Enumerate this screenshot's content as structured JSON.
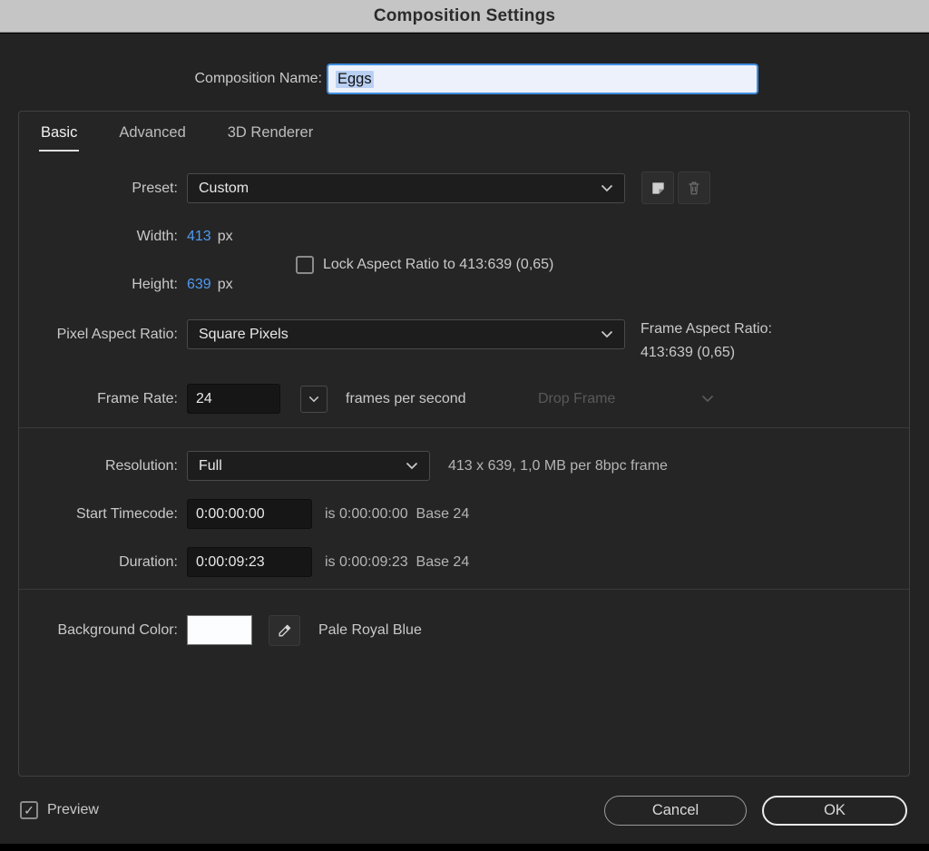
{
  "title": "Composition Settings",
  "name_row": {
    "label": "Composition Name:",
    "value": "Eggs"
  },
  "tabs": [
    {
      "label": "Basic",
      "active": true
    },
    {
      "label": "Advanced",
      "active": false
    },
    {
      "label": "3D Renderer",
      "active": false
    }
  ],
  "preset": {
    "label": "Preset:",
    "value": "Custom"
  },
  "width": {
    "label": "Width:",
    "value": "413",
    "unit": "px"
  },
  "height": {
    "label": "Height:",
    "value": "639",
    "unit": "px"
  },
  "lock_aspect": {
    "label": "Lock Aspect Ratio to 413:639 (0,65)",
    "checked": false
  },
  "pixel_aspect": {
    "label": "Pixel Aspect Ratio:",
    "value": "Square Pixels"
  },
  "frame_aspect": {
    "label": "Frame Aspect Ratio:",
    "value": "413:639 (0,65)"
  },
  "frame_rate": {
    "label": "Frame Rate:",
    "value": "24",
    "suffix": "frames per second",
    "drop_frame": "Drop Frame"
  },
  "resolution": {
    "label": "Resolution:",
    "value": "Full",
    "info": "413 x 639, 1,0 MB per 8bpc frame"
  },
  "start_timecode": {
    "label": "Start Timecode:",
    "value": "0:00:00:00",
    "info": "is 0:00:00:00  Base 24"
  },
  "duration": {
    "label": "Duration:",
    "value": "0:00:09:23",
    "info": "is 0:00:09:23  Base 24"
  },
  "background_color": {
    "label": "Background Color:",
    "swatch_hex": "#fcfdff",
    "name": "Pale Royal Blue"
  },
  "footer": {
    "preview_label": "Preview",
    "preview_checked": true,
    "cancel_label": "Cancel",
    "ok_label": "OK"
  },
  "colors": {
    "accent_blue": "#4f9bf0",
    "selection_blue": "#3f8de0",
    "titlebar": "#c5c5c5",
    "dialog_bg": "#232323"
  }
}
